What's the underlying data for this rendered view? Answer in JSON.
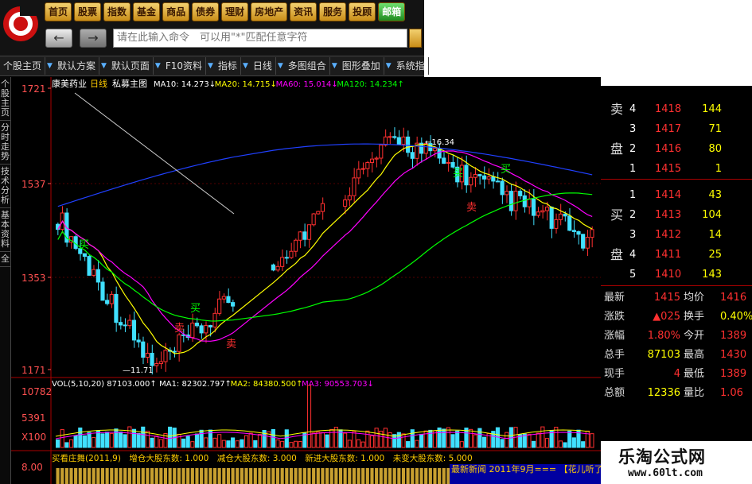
{
  "nav_items": [
    "首页",
    "股票",
    "指数",
    "基金",
    "商品",
    "债券",
    "理财",
    "房地产",
    "资讯",
    "服务",
    "投顾",
    "邮箱"
  ],
  "command_placeholder": "请在此输入命令　可以用\"*\"匹配任意字符",
  "tabs": [
    "个股主页",
    "默认方案",
    "默认页面",
    "F10资料",
    "指标",
    "日线",
    "多图组合",
    "图形叠加",
    "系统指"
  ],
  "side_tabs": [
    "个股主页",
    "分时走势",
    "技术分析",
    "基本资料",
    "全"
  ],
  "main_chart": {
    "header": {
      "stock": "康美药业",
      "period": "日线",
      "view": "私募主图",
      "ma": [
        {
          "label": "MA10:",
          "value": "14.273",
          "arrow": "↓",
          "color": "#ffffff"
        },
        {
          "label": "MA20:",
          "value": "14.715",
          "arrow": "↓",
          "color": "#ffff00"
        },
        {
          "label": "MA60:",
          "value": "15.014",
          "arrow": "↓",
          "color": "#ff00ff"
        },
        {
          "label": "MA120:",
          "value": "14.234",
          "arrow": "↑",
          "color": "#00ff00"
        }
      ]
    },
    "y_ticks": [
      "1721",
      "1537",
      "1353",
      "1171"
    ],
    "annotations": {
      "high": "16.34",
      "low": "11.71"
    },
    "signals": {
      "buy": "买",
      "sell": "卖"
    }
  },
  "volume": {
    "header": [
      {
        "label": "VOL(5,10,20)",
        "value": "87103.000",
        "arrow": "↑",
        "color": "#ffffff"
      },
      {
        "label": "MA1:",
        "value": "82302.797",
        "arrow": "↑",
        "color": "#ffffff"
      },
      {
        "label": "MA2:",
        "value": "84380.500",
        "arrow": "↑",
        "color": "#ffff00"
      },
      {
        "label": "MA3:",
        "value": "90553.703",
        "arrow": "↓",
        "color": "#ff00ff"
      }
    ],
    "y_ticks": [
      "10782",
      "5391",
      "X100"
    ]
  },
  "indicator": {
    "text": "买看庄舞(2011,9)　增仓大股东数: 1.000　减仓大股东数: 3.000　新进大股东数: 1.000　未变大股东数: 5.000",
    "y_tick": "8.00"
  },
  "order_book": {
    "sell": [
      {
        "level": "4",
        "price": "1418",
        "vol": "144"
      },
      {
        "level": "3",
        "price": "1417",
        "vol": "71"
      },
      {
        "level": "2",
        "price": "1416",
        "vol": "80"
      },
      {
        "level": "1",
        "price": "1415",
        "vol": "1"
      }
    ],
    "sell_label": [
      "卖",
      "盘"
    ],
    "buy": [
      {
        "level": "1",
        "price": "1414",
        "vol": "43"
      },
      {
        "level": "2",
        "price": "1413",
        "vol": "104"
      },
      {
        "level": "3",
        "price": "1412",
        "vol": "14"
      },
      {
        "level": "4",
        "price": "1411",
        "vol": "25"
      },
      {
        "level": "5",
        "price": "1410",
        "vol": "143"
      }
    ],
    "buy_label": [
      "买",
      "盘"
    ]
  },
  "quote": [
    {
      "l": "最新",
      "v": "1415",
      "l2": "均价",
      "v2": "1416"
    },
    {
      "l": "涨跌",
      "v": "▲025",
      "l2": "换手",
      "v2": "0.40%"
    },
    {
      "l": "涨幅",
      "v": "1.80%",
      "l2": "今开",
      "v2": "1389"
    },
    {
      "l": "总手",
      "v": "87103",
      "l2": "最高",
      "v2": "1430"
    },
    {
      "l": "现手",
      "v": "4",
      "l2": "最低",
      "v2": "1389"
    },
    {
      "l": "总额",
      "v": "12336",
      "l2": "量比",
      "v2": "1.06"
    }
  ],
  "watermark": {
    "title": "乐淘公式网",
    "url": "www.60lt.com"
  },
  "bottom_strip": "最新新闻 2011年9月=== 【花儿听了",
  "colors": {
    "up": "#ff3030",
    "down": "#40e0ff",
    "ma10": "#ffffff",
    "ma20": "#ffff00",
    "ma60": "#ff00ff",
    "ma120": "#00ff00",
    "ma_long": "#2040ff"
  }
}
